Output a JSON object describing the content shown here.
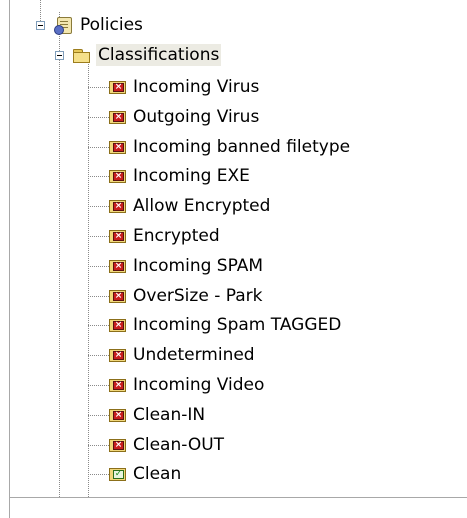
{
  "tree": {
    "root": {
      "label": "Policies",
      "icon": "policies-icon",
      "expanded": true
    },
    "folder": {
      "label": "Classifications",
      "icon": "folder-icon",
      "expanded": true,
      "selected": true
    },
    "items": [
      {
        "label": "Incoming Virus",
        "status": "deny"
      },
      {
        "label": "Outgoing Virus",
        "status": "deny"
      },
      {
        "label": "Incoming banned filetype",
        "status": "deny"
      },
      {
        "label": "Incoming EXE",
        "status": "deny"
      },
      {
        "label": "Allow Encrypted",
        "status": "deny"
      },
      {
        "label": "Encrypted",
        "status": "deny"
      },
      {
        "label": "Incoming SPAM",
        "status": "deny"
      },
      {
        "label": "OverSize - Park",
        "status": "deny"
      },
      {
        "label": "Incoming Spam TAGGED",
        "status": "deny"
      },
      {
        "label": "Undetermined",
        "status": "deny"
      },
      {
        "label": "Incoming Video",
        "status": "deny"
      },
      {
        "label": "Clean-IN",
        "status": "deny"
      },
      {
        "label": "Clean-OUT",
        "status": "deny"
      },
      {
        "label": "Clean",
        "status": "allow"
      }
    ]
  },
  "icons": {
    "deny": "red-x-icon",
    "allow": "green-check-icon"
  },
  "colors": {
    "selection": "#ecebe3",
    "deny": "#c81e1e",
    "allow": "#1d8a1d"
  }
}
